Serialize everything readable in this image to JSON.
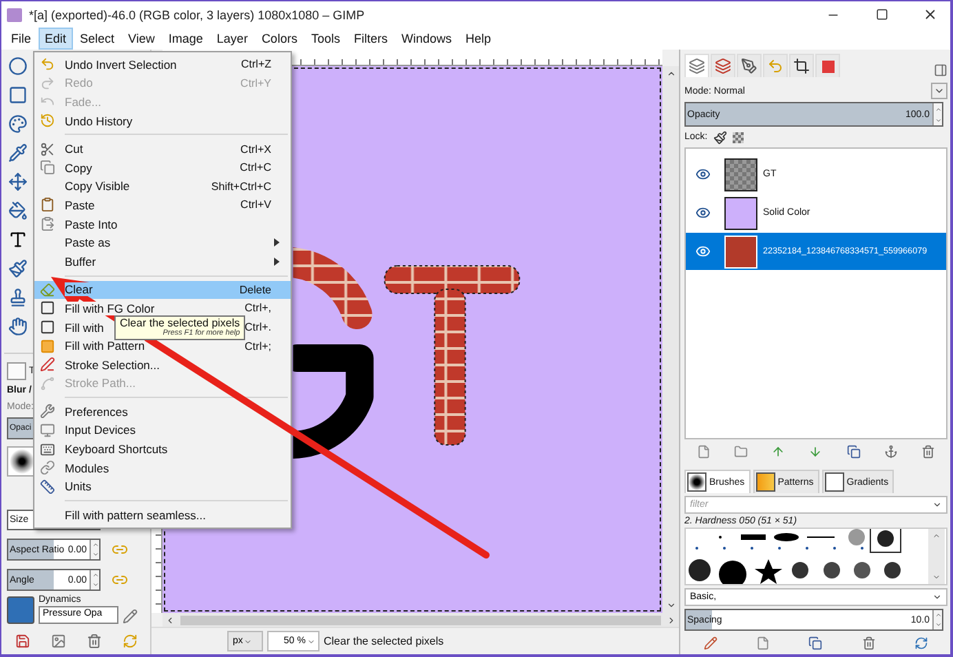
{
  "window": {
    "title": "*[a] (exported)-46.0 (RGB color, 3 layers) 1080x1080 – GIMP"
  },
  "menubar": [
    {
      "label": "File",
      "selected": false
    },
    {
      "label": "Edit",
      "selected": true
    },
    {
      "label": "Select",
      "selected": false
    },
    {
      "label": "View",
      "selected": false
    },
    {
      "label": "Image",
      "selected": false
    },
    {
      "label": "Layer",
      "selected": false
    },
    {
      "label": "Colors",
      "selected": false
    },
    {
      "label": "Tools",
      "selected": false
    },
    {
      "label": "Filters",
      "selected": false
    },
    {
      "label": "Windows",
      "selected": false
    },
    {
      "label": "Help",
      "selected": false
    }
  ],
  "edit_menu": {
    "sections": [
      [
        {
          "label": "Undo Invert Selection",
          "shortcut": "Ctrl+Z",
          "disabled": false,
          "selected": false,
          "submenu": false
        },
        {
          "label": "Redo",
          "shortcut": "Ctrl+Y",
          "disabled": true,
          "selected": false,
          "submenu": false
        },
        {
          "label": "Fade...",
          "disabled": true,
          "selected": false,
          "submenu": false
        },
        {
          "label": "Undo History",
          "disabled": false,
          "selected": false,
          "submenu": false
        }
      ],
      [
        {
          "label": "Cut",
          "shortcut": "Ctrl+X",
          "disabled": false,
          "selected": false,
          "submenu": false
        },
        {
          "label": "Copy",
          "shortcut": "Ctrl+C",
          "disabled": false,
          "selected": false,
          "submenu": false
        },
        {
          "label": "Copy Visible",
          "shortcut": "Shift+Ctrl+C",
          "disabled": false,
          "selected": false,
          "submenu": false
        },
        {
          "label": "Paste",
          "shortcut": "Ctrl+V",
          "disabled": false,
          "selected": false,
          "submenu": false
        },
        {
          "label": "Paste Into",
          "disabled": false,
          "selected": false,
          "submenu": false
        },
        {
          "label": "Paste as",
          "disabled": false,
          "selected": false,
          "submenu": true
        },
        {
          "label": "Buffer",
          "disabled": false,
          "selected": false,
          "submenu": true
        }
      ],
      [
        {
          "label": "Clear",
          "shortcut": "Delete",
          "disabled": false,
          "selected": true,
          "submenu": false
        },
        {
          "label": "Fill with FG Color",
          "shortcut": "Ctrl+,",
          "disabled": false,
          "selected": false,
          "submenu": false
        },
        {
          "label": "Fill with",
          "shortcut": "Ctrl+.",
          "disabled": false,
          "selected": false,
          "submenu": false
        },
        {
          "label": "Fill with Pattern",
          "shortcut": "Ctrl+;",
          "disabled": false,
          "selected": false,
          "submenu": false
        },
        {
          "label": "Stroke Selection...",
          "disabled": false,
          "selected": false,
          "submenu": false
        },
        {
          "label": "Stroke Path...",
          "disabled": true,
          "selected": false,
          "submenu": false
        }
      ],
      [
        {
          "label": "Preferences",
          "disabled": false,
          "selected": false,
          "submenu": false
        },
        {
          "label": "Input Devices",
          "disabled": false,
          "selected": false,
          "submenu": false
        },
        {
          "label": "Keyboard Shortcuts",
          "disabled": false,
          "selected": false,
          "submenu": false
        },
        {
          "label": "Modules",
          "disabled": false,
          "selected": false,
          "submenu": false
        },
        {
          "label": "Units",
          "disabled": false,
          "selected": false,
          "submenu": false
        }
      ],
      [
        {
          "label": "Fill with pattern seamless...",
          "disabled": false,
          "selected": false,
          "submenu": false
        }
      ]
    ]
  },
  "tooltip": {
    "text": "Clear the selected pixels",
    "hint": "Press F1 for more help"
  },
  "tool_options": {
    "tab_label": "T",
    "tool": "Blur /",
    "mode_label": "Mode:",
    "opacity": {
      "label": "Opaci",
      "level": 1
    },
    "size": {
      "label": "Size"
    },
    "aspect_ratio": {
      "label": "Aspect Ratio",
      "value": "0.00",
      "level": 0.5
    },
    "angle": {
      "label": "Angle",
      "value": "0.00",
      "level": 0.5
    },
    "dynamics": {
      "label": "Dynamics",
      "value": "Pressure Opa"
    }
  },
  "status_bar": {
    "unit": "px",
    "zoom": "50 %",
    "message": "Clear the selected pixels"
  },
  "layers_panel": {
    "mode": "Mode: Normal",
    "opacity": {
      "label": "Opacity",
      "value": "100.0",
      "level": 1
    },
    "lock_label": "Lock:",
    "layers": [
      {
        "name": "GT",
        "visible": true,
        "selected": false,
        "kind": "transparent"
      },
      {
        "name": "Solid Color",
        "visible": true,
        "selected": false,
        "kind": "solid"
      },
      {
        "name": "22352184_123846768334571_559966079",
        "visible": true,
        "selected": true,
        "kind": "photo"
      }
    ]
  },
  "brushes_panel": {
    "tabs": [
      {
        "label": "Brushes",
        "selected": true
      },
      {
        "label": "Patterns",
        "selected": false
      },
      {
        "label": "Gradients",
        "selected": false
      }
    ],
    "filter_placeholder": "filter",
    "brush_name": "2. Hardness 050 (51 × 51)",
    "tag": "Basic,",
    "spacing": {
      "label": "Spacing",
      "value": "10.0",
      "level": 0.1
    }
  }
}
